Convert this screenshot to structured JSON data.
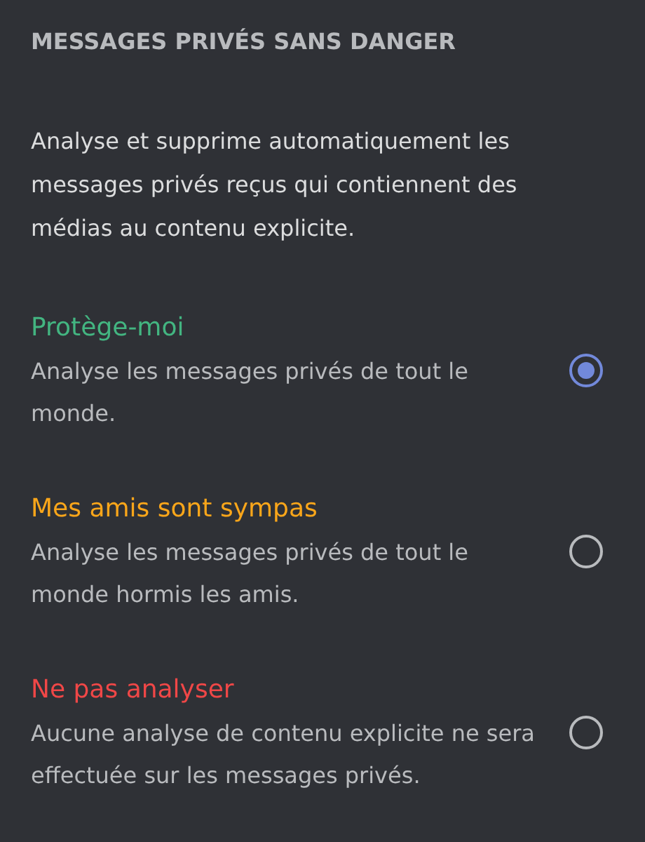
{
  "section": {
    "title": "MESSAGES PRIVÉS SANS DANGER",
    "description": "Analyse et supprime automatiquement les messages privés reçus qui contiennent des médias au contenu explicite."
  },
  "options": [
    {
      "label": "Protège-moi",
      "description": "Analyse les messages privés de tout le monde.",
      "color": "#43b581",
      "selected": true
    },
    {
      "label": "Mes amis sont sympas",
      "description": "Analyse les messages privés de tout le monde hormis les amis.",
      "color": "#faa61a",
      "selected": false
    },
    {
      "label": "Ne pas analyser",
      "description": "Aucune analyse de contenu explicite ne sera effectuée sur les messages privés.",
      "color": "#f04747",
      "selected": false
    }
  ]
}
